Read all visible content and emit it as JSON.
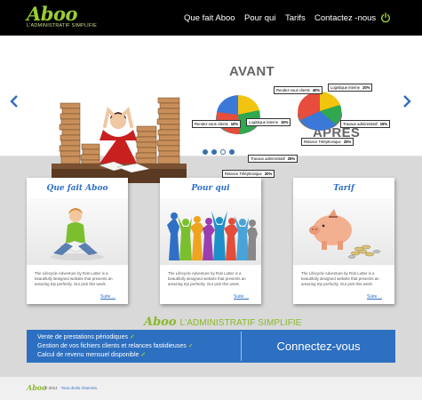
{
  "brand": {
    "logo": "Aboo",
    "tagline": "L'ADMINISTRATIF SIMPLIFIE"
  },
  "nav": {
    "items": [
      {
        "label": "Que fait Aboo"
      },
      {
        "label": "Pour qui"
      },
      {
        "label": "Tarifs"
      },
      {
        "label": "Contactez -nous"
      }
    ],
    "power_icon": "power-icon"
  },
  "hero": {
    "before_label": "AVANT",
    "after_label": "APRES",
    "slides_total": 4,
    "active_slide": 3,
    "before_pie": [
      {
        "label": "Rendez-vous clients",
        "pct": "10%",
        "color": "#3b78d8"
      },
      {
        "label": "Logistique interne",
        "pct": "15%",
        "color": "#f1c40f"
      },
      {
        "label": "Travaux administratif",
        "pct": "25%",
        "color": "#2fa84f"
      },
      {
        "label": "Relance Téléphonique",
        "pct": "20%",
        "color": "#e74c3c"
      }
    ],
    "after_pie": [
      {
        "label": "Rendez-vous clients",
        "pct": "40%",
        "color": "#e74c3c"
      },
      {
        "label": "Logistique interne",
        "pct": "20%",
        "color": "#f1c40f"
      },
      {
        "label": "Travaux administratif",
        "pct": "15%",
        "color": "#2fa84f"
      },
      {
        "label": "Relance Téléphonique",
        "pct": "25%",
        "color": "#3b78d8"
      }
    ]
  },
  "cards": [
    {
      "title": "Que fait Aboo",
      "desc": "The Lifecycle Adventure by Rob Lutter is a beautifully designed website that presents an amazing trip perfectly. Our pick this week.",
      "more": "Suite ..."
    },
    {
      "title": "Pour qui",
      "desc": "The Lifecycle Adventure by Rob Lutter is a beautifully designed website that presents an amazing trip perfectly. Our pick this week.",
      "more": "Suite ..."
    },
    {
      "title": "Tarif",
      "desc": "The Lifecycle Adventure by Rob Lutter is a beautifully designed website that presents an amazing trip perfectly. Our pick this week.",
      "more": "Suite ..."
    }
  ],
  "promo": {
    "logo": "Aboo",
    "tagline": "L'ADMINISTRATIF SIMPLIFIE",
    "features": [
      "Vente de prestations périodiques",
      "Gestion de vos fichiers clients et  relances fastidieuses",
      "Calcul de revenu mensuel disponible"
    ],
    "cta": "Connectez-vous"
  },
  "footer": {
    "logo": "Aboo",
    "copyright": "© 2014",
    "rights": "Tous droits réservés."
  },
  "colors": {
    "accent": "#9acd32",
    "brand_blue": "#2d6fc0",
    "nav_bg": "#000000"
  }
}
